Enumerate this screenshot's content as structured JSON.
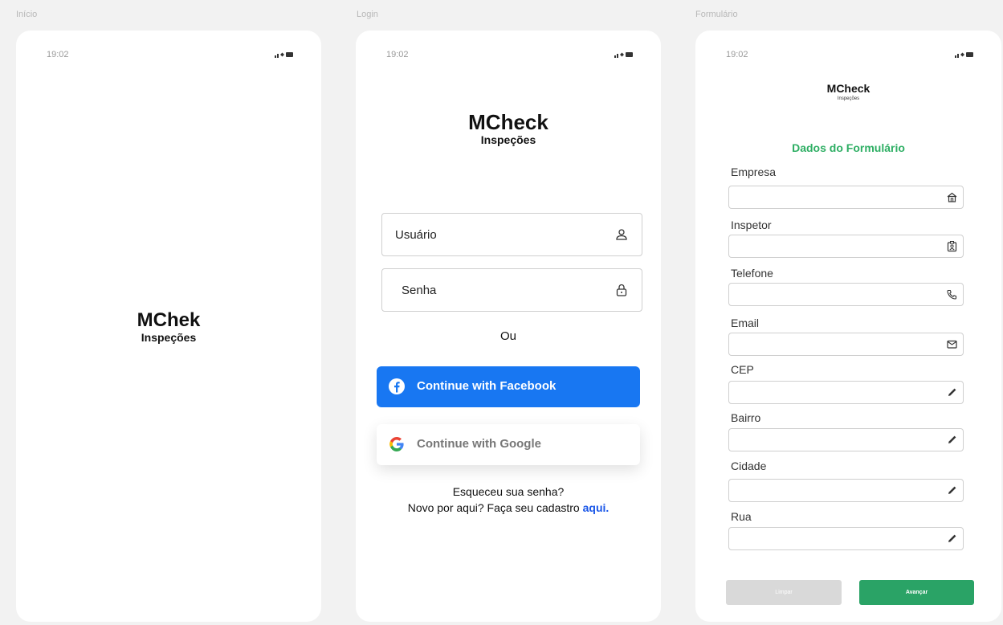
{
  "frames": {
    "inicio": "Início",
    "login": "Login",
    "formulario": "Formulário"
  },
  "status": {
    "time": "19:02"
  },
  "splash": {
    "title": "MChek",
    "subtitle": "Inspeções"
  },
  "login": {
    "title": "MCheck",
    "subtitle": "Inspeções",
    "username_label": "Usuário",
    "password_label": "Senha",
    "or": "Ou",
    "facebook_label": "Continue with Facebook",
    "google_label": "Continue with Google",
    "forgot": "Esqueceu sua senha?",
    "signup_prefix": "Novo por aqui? Faça seu cadastro ",
    "signup_link": "aqui."
  },
  "form": {
    "title": "MCheck",
    "subtitle": "Inspeções",
    "heading": "Dados do Formulário",
    "fields": {
      "empresa": "Empresa",
      "inspetor": "Inspetor",
      "telefone": "Telefone",
      "email": "Email",
      "cep": "CEP",
      "bairro": "Bairro",
      "cidade": "Cidade",
      "rua": "Rua"
    },
    "clear_label": "Limpar",
    "next_label": "Avançar"
  },
  "colors": {
    "facebook": "#1877f2",
    "accent_green": "#2dae63",
    "link_blue": "#1a57e8"
  }
}
